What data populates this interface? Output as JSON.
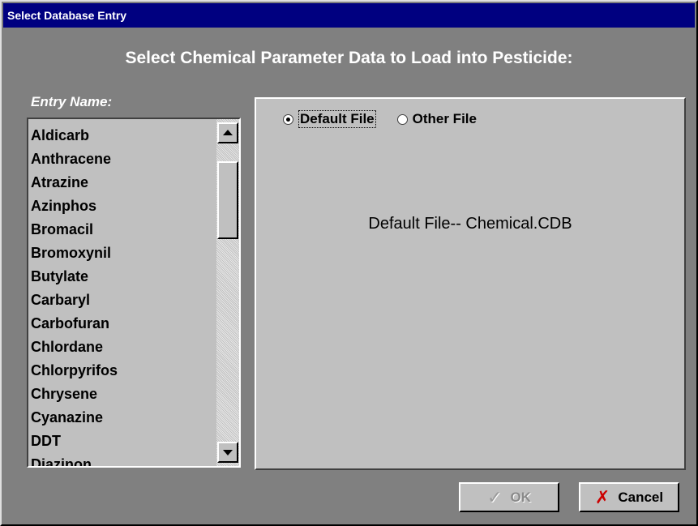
{
  "window": {
    "title": "Select Database Entry"
  },
  "heading": "Select Chemical Parameter Data to Load into Pesticide:",
  "list": {
    "label": "Entry Name:",
    "items": [
      "Aldicarb",
      "Anthracene",
      "Atrazine",
      "Azinphos",
      "Bromacil",
      "Bromoxynil",
      "Butylate",
      "Carbaryl",
      "Carbofuran",
      "Chlordane",
      "Chlorpyrifos",
      "Chrysene",
      "Cyanazine",
      "DDT",
      "Diazinon"
    ]
  },
  "source": {
    "options": [
      {
        "label": "Default File",
        "selected": true
      },
      {
        "label": "Other File",
        "selected": false
      }
    ],
    "file_text": "Default File--  Chemical.CDB"
  },
  "buttons": {
    "ok_label": "OK",
    "ok_enabled": false,
    "cancel_label": "Cancel"
  },
  "icons": {
    "ok": "check-icon",
    "cancel": "red-x-icon"
  },
  "colors": {
    "titlebar": "#000080",
    "background": "#808080",
    "panel": "#c0c0c0",
    "cancel_x": "#cc0000"
  }
}
